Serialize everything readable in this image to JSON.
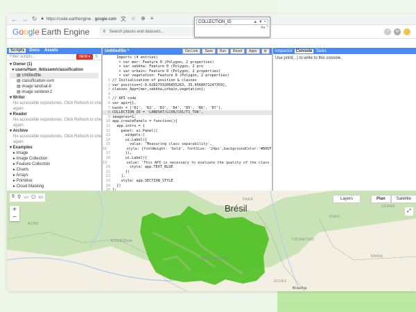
{
  "browser": {
    "url_prefix": "https://code.earthengine.",
    "url_domain": "google.com"
  },
  "app": {
    "logo_letters": [
      "G",
      "o",
      "o",
      "g",
      "l",
      "e"
    ],
    "product": "Earth Engine",
    "search_placeholder": "Search places and datasets..."
  },
  "left_panel": {
    "tabs": [
      "Scripts",
      "Docs",
      "Assets"
    ],
    "filter_placeholder": "Filter scripts...",
    "new_label": "NEW",
    "tree": [
      {
        "text": "▾ Owner (1)",
        "cls": "h"
      },
      {
        "text": "  ▾ users/Ham_Ibtissem/classification",
        "cls": "h"
      },
      {
        "text": "      ▤ Untitledfile",
        "cls": "sel"
      },
      {
        "text": "      ▤ classification-svm",
        "cls": ""
      },
      {
        "text": "      ▤ image landsat-8",
        "cls": ""
      },
      {
        "text": "      ▤ image sentinel-2",
        "cls": ""
      },
      {
        "text": "▾ Writer",
        "cls": "h"
      },
      {
        "text": "   No accessible repositories. Click Refresh to check",
        "cls": "gray"
      },
      {
        "text": "   again.",
        "cls": "gray"
      },
      {
        "text": "▾ Reader",
        "cls": "h"
      },
      {
        "text": "   No accessible repositories. Click Refresh to check",
        "cls": "gray"
      },
      {
        "text": "   again.",
        "cls": "gray"
      },
      {
        "text": "▾ Archive",
        "cls": "h"
      },
      {
        "text": "   No accessible repositories. Click Refresh to check",
        "cls": "gray"
      },
      {
        "text": "   again.",
        "cls": "gray"
      },
      {
        "text": "▾ Examples",
        "cls": "h"
      },
      {
        "text": "   ▸ Image",
        "cls": ""
      },
      {
        "text": "   ▸ Image Collection",
        "cls": ""
      },
      {
        "text": "   ▸ Feature Collection",
        "cls": ""
      },
      {
        "text": "   ▸ Charts",
        "cls": ""
      },
      {
        "text": "   ▸ Arrays",
        "cls": ""
      },
      {
        "text": "   ▸ Primitive",
        "cls": ""
      },
      {
        "text": "   ▸ Cloud Masking",
        "cls": ""
      }
    ]
  },
  "editor": {
    "file_title": "Untitledfile *",
    "buttons": [
      "Get Link",
      "Save",
      "Run",
      "Reset",
      "Apps"
    ],
    "popup_value": "COLLECTION_ID",
    "popup_options": "Aa  .*",
    "lines": [
      {
        "n": "",
        "c": "  Imports (4 entries)"
      },
      {
        "n": "",
        "c": "   ▾ var mer: Feature 0 (Polygon, 2 properties)"
      },
      {
        "n": "",
        "c": "   ▾ var sebkha: Feature 0 (Polygon, 2 pro"
      },
      {
        "n": "",
        "c": "   ▾ var urbain: Feature 0 (Polygon, 2 properties)"
      },
      {
        "n": "",
        "c": "   ▾ var vegetation: Feature 0 (Polygon, 2 properties)"
      },
      {
        "n": "1",
        "c": "// Initialisation of position & classes"
      },
      {
        "n": "2",
        "c": "var position=[-0.6282793206855263, 35.6568071247359],"
      },
      {
        "n": "3",
        "c": "classes_App=[mer,sebkha,urbain,vegetation];"
      },
      {
        "n": "4",
        "c": ""
      },
      {
        "n": "5",
        "c": "// API code"
      },
      {
        "n": "6",
        "c": "var api={},"
      },
      {
        "n": "7",
        "c": "bands = ['B1', 'B2', 'B3', 'B4', 'B5', 'B6', 'B7'],"
      },
      {
        "n": "8",
        "c": "COLLECTION_ID = 'LANDSAT/LC08/C01/T1_TOA',",
        "hl": true
      },
      {
        "n": "9",
        "c": "imageres=1;"
      },
      {
        "n": "10",
        "c": "app.createPanels = function(){"
      },
      {
        "n": "11",
        "c": "  app.intro = {"
      },
      {
        "n": "12",
        "c": "    panel: ui.Panel(["
      },
      {
        "n": "13",
        "c": "      widgets:["
      },
      {
        "n": "14",
        "c": "      ui.Label({"
      },
      {
        "n": "15",
        "c": "        value: 'Measuring class separability',"
      },
      {
        "n": "16",
        "c": "        style: {fontWeight: 'bold', fontSize: '24px',backgroundColor:'#B0DF16',co"
      },
      {
        "n": "17",
        "c": "      }),"
      },
      {
        "n": "18",
        "c": "      ui.Label({"
      },
      {
        "n": "19",
        "c": "        value: 'This API is necessary to evaluate the quality of the class repres"
      },
      {
        "n": "20",
        "c": "        style: app.TEXT_BLUE"
      },
      {
        "n": "21",
        "c": "      })"
      },
      {
        "n": "22",
        "c": "    ],"
      },
      {
        "n": "23",
        "c": "    style: app.SECTION_STYLE"
      },
      {
        "n": "24",
        "c": "  })"
      },
      {
        "n": "25",
        "c": "};"
      }
    ]
  },
  "right_panel": {
    "tabs": [
      "Inspector",
      "Console",
      "Tasks"
    ],
    "active": "Console",
    "console_text": "Use print(...) to write to this console."
  },
  "map": {
    "country_label": "Brésil",
    "layers_label": "Layers",
    "map_types": [
      "Plan",
      "Satellite"
    ],
    "labels": [
      {
        "t": "RONDÔNIA"
      },
      {
        "t": "MATO GROSSO"
      },
      {
        "t": "TOCANTINS"
      },
      {
        "t": "BAHIA"
      },
      {
        "t": "GOIÁS"
      },
      {
        "t": "Brasília"
      },
      {
        "t": "PARÁ"
      },
      {
        "t": "ACRE"
      },
      {
        "t": "PIAUÍ"
      },
      {
        "t": "CEARÁ"
      }
    ],
    "colors": {
      "land": "#f3efe3",
      "forest": "#c9e3b7",
      "classified": "#4cc020",
      "border": "#999999",
      "water": "#aacdf0"
    }
  }
}
